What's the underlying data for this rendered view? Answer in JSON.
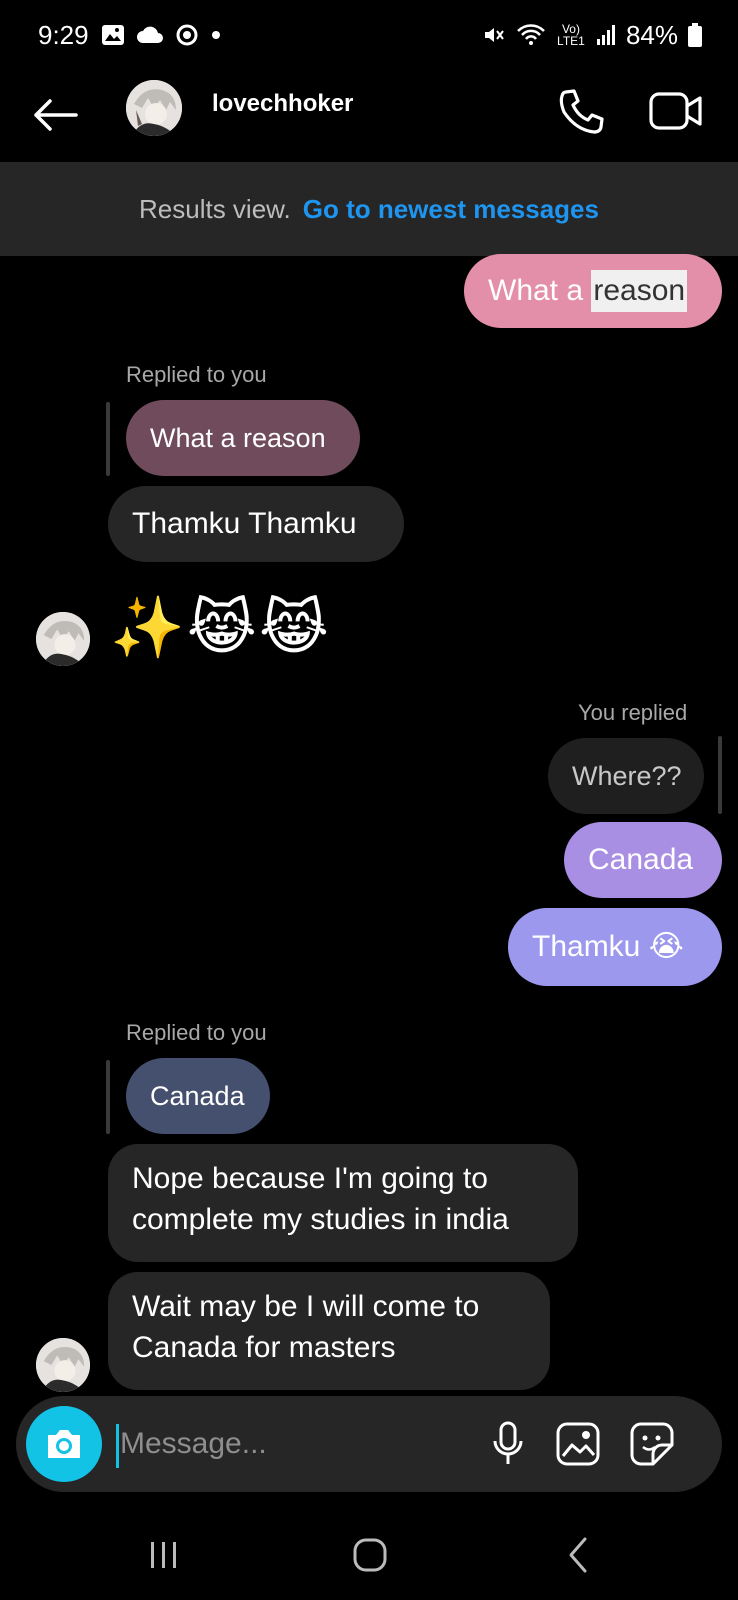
{
  "status_bar": {
    "time": "9:29",
    "battery": "84%",
    "network": "Vo) LTE1"
  },
  "header": {
    "username": "lovechhoker"
  },
  "banner": {
    "label": "Results view.",
    "link": "Go to newest messages"
  },
  "messages": {
    "m1": {
      "prefix": "What a ",
      "highlighted": "reason"
    },
    "reply1_meta": "Replied to you",
    "reply1_quote": "What a reason",
    "m2": "Thamku Thamku",
    "m3_emoji": "✨😹😹",
    "you_replied_meta": "You replied",
    "you_replied_quote": "Where??",
    "m4": "Canada",
    "m5": "Thamku 😭",
    "reply2_meta": "Replied to you",
    "reply2_quote": "Canada",
    "m6_line1": "Nope because I'm going to",
    "m6_line2": "complete my studies in india",
    "m7_line1": "Wait may be I will come to",
    "m7_line2": "Canada for masters"
  },
  "composer": {
    "placeholder": "Message..."
  },
  "colors": {
    "accent_blue": "#1e95f0",
    "camera_cyan": "#12c3e6",
    "bubble_pink": "#e48faa",
    "bubble_purple_1": "#a88fe4",
    "bubble_purple_2": "#9c98ee",
    "incoming_gray": "#262626"
  }
}
